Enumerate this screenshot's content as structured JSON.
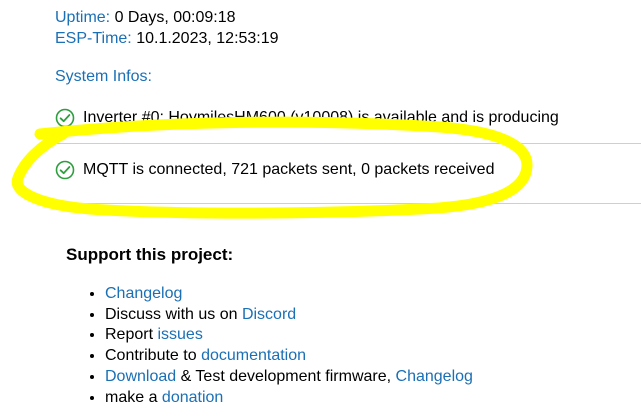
{
  "uptime": {
    "label": "Uptime:",
    "value": " 0 Days, 00:09:18"
  },
  "esp_time": {
    "label": "ESP-Time:",
    "value": " 10.1.2023, 12:53:19"
  },
  "system_infos": {
    "title": "System Infos:",
    "items": [
      {
        "text": "Inverter #0: HoymilesHM600 (v10008) is available and is producing",
        "icon": "check-circle-icon"
      },
      {
        "text": "MQTT is connected, 721 packets sent, 0 packets received",
        "icon": "check-circle-icon"
      }
    ]
  },
  "highlight_color": "#ffff00",
  "support": {
    "title": "Support this project:",
    "items": {
      "changelog": "Changelog",
      "discuss_prefix": "Discuss with us on ",
      "discord": "Discord",
      "report_prefix": "Report ",
      "issues": "issues",
      "contribute_prefix": "Contribute to ",
      "documentation": "documentation",
      "download": "Download",
      "test_mid": " & Test development firmware, ",
      "changelog2": "Changelog",
      "donation_prefix": "make a ",
      "donation": "donation"
    }
  }
}
